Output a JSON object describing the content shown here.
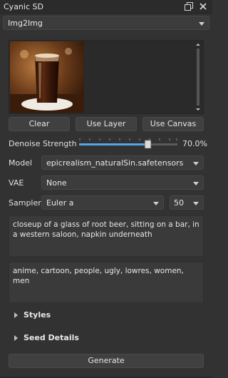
{
  "window": {
    "title": "Cyanic SD"
  },
  "mode": {
    "selected": "Img2Img"
  },
  "image_actions": {
    "clear": "Clear",
    "use_layer": "Use Layer",
    "use_canvas": "Use Canvas"
  },
  "denoise": {
    "label": "Denoise Strength",
    "value_text": "70.0%",
    "value": 0.7
  },
  "model": {
    "label": "Model",
    "selected": "epicrealism_naturalSin.safetensors"
  },
  "vae": {
    "label": "VAE",
    "selected": "None"
  },
  "sampler": {
    "label": "Sampler",
    "selected": "Euler a",
    "steps": "50"
  },
  "prompt": {
    "positive": "closeup of a glass of root beer, sitting on a bar, in a western saloon, napkin underneath",
    "negative": "anime, cartoon, people, ugly, lowres, women, men"
  },
  "sections": {
    "styles": "Styles",
    "seed": "Seed Details"
  },
  "generate": {
    "label": "Generate"
  },
  "icons": {
    "float": "float-window-icon",
    "close": "close-icon"
  }
}
